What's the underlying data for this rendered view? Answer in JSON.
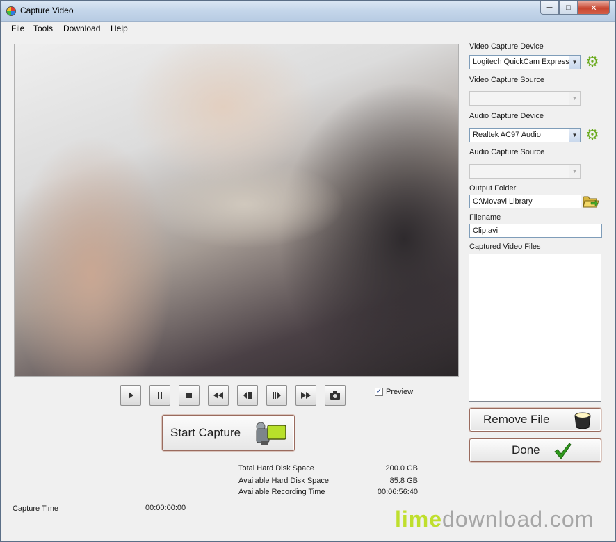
{
  "window": {
    "title": "Capture Video"
  },
  "menu": [
    "File",
    "Tools",
    "Download",
    "Help"
  ],
  "player": {
    "controls": [
      "play-icon",
      "pause-icon",
      "stop-icon",
      "rewind-icon",
      "step-back-icon",
      "step-forward-icon",
      "fast-forward-icon",
      "snapshot-icon"
    ],
    "preview_label": "Preview",
    "preview_checked": true
  },
  "start_capture_label": "Start Capture",
  "stats": {
    "total_label": "Total Hard Disk Space",
    "total_value": "200.0 GB",
    "available_label": "Available Hard Disk Space",
    "available_value": "85.8 GB",
    "recording_label": "Available Recording Time",
    "recording_value": "00:06:56:40"
  },
  "capture_time": {
    "label": "Capture Time",
    "value": "00:00:00:00"
  },
  "settings": {
    "video_device_label": "Video Capture Device",
    "video_device_value": "Logitech QuickCam Express",
    "video_source_label": "Video Capture Source",
    "video_source_value": "",
    "audio_device_label": "Audio Capture Device",
    "audio_device_value": "Realtek AC97 Audio",
    "audio_source_label": "Audio Capture Source",
    "audio_source_value": "",
    "output_folder_label": "Output Folder",
    "output_folder_value": "C:\\Movavi Library",
    "filename_label": "Filename",
    "filename_value": "Clip.avi",
    "captured_files_label": "Captured Video Files",
    "captured_files": []
  },
  "remove_file_label": "Remove File",
  "done_label": "Done",
  "watermark": {
    "lime": "lime",
    "rest": "download.com"
  },
  "colors": {
    "accent_green": "#6bab1f",
    "button_border": "#9a6b5e",
    "watermark_lime": "#bfdf2d"
  }
}
